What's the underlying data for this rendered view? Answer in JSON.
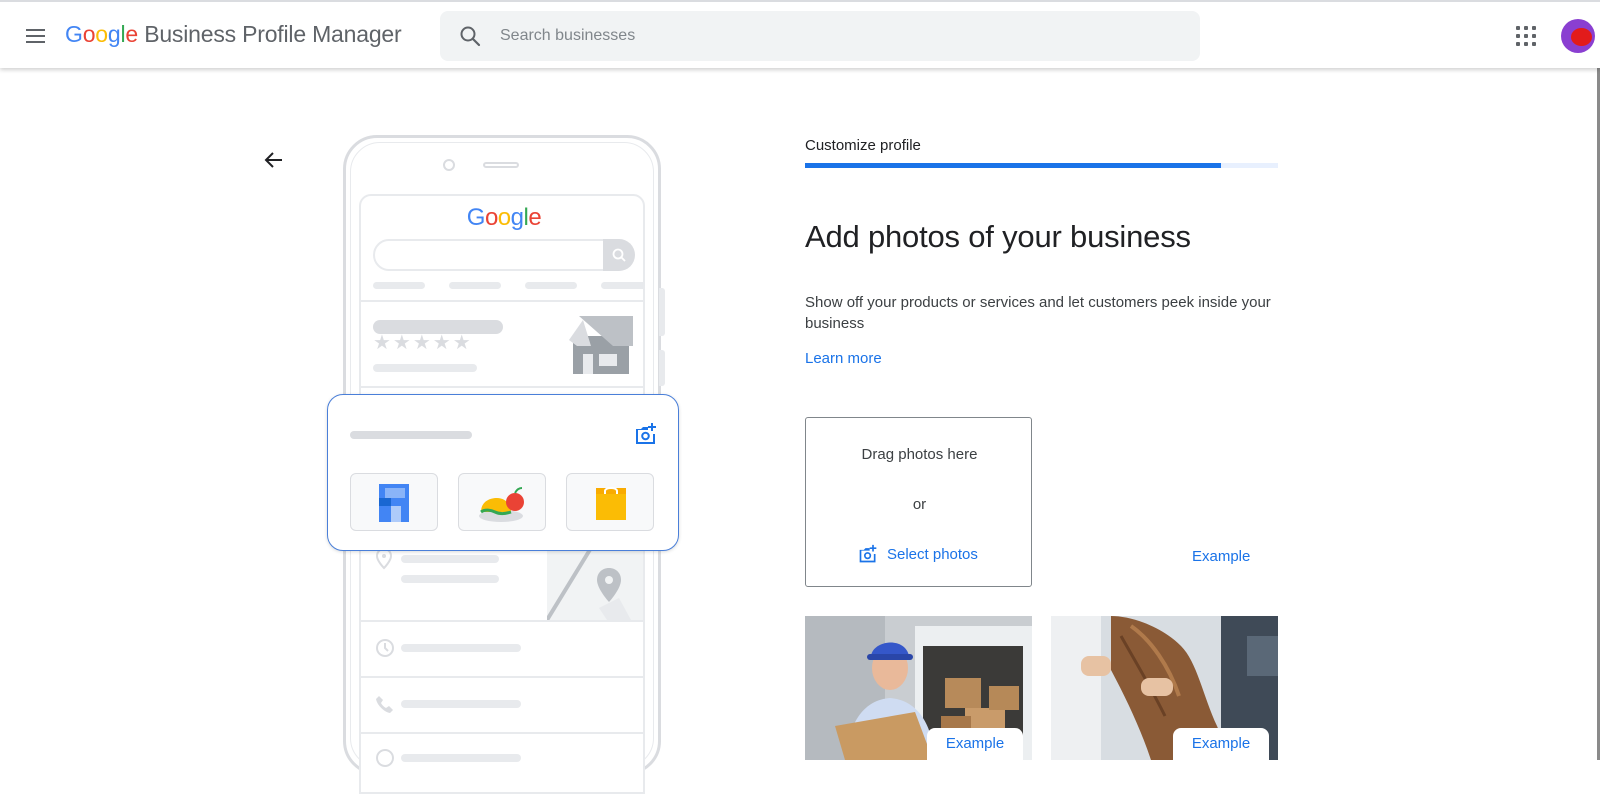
{
  "header": {
    "brand_google": [
      "G",
      "o",
      "o",
      "g",
      "l",
      "e"
    ],
    "brand_rest": "Business Profile Manager",
    "search_placeholder": "Search businesses",
    "menu_icon": "hamburger-menu-icon",
    "apps_icon": "apps-grid-icon"
  },
  "illustration": {
    "mini_logo": [
      "G",
      "o",
      "o",
      "g",
      "l",
      "e"
    ]
  },
  "main": {
    "step_label": "Customize profile",
    "progress_percent": 88,
    "title": "Add photos of your business",
    "description": "Show off your products or services and let customers peek inside your business",
    "learn_more": "Learn more",
    "dropzone": {
      "drag_text": "Drag photos here",
      "or_text": "or",
      "select_label": "Select photos"
    },
    "example_labels": [
      "Example",
      "Example",
      "Example"
    ]
  },
  "colors": {
    "accent": "#1a73e8",
    "google_blue": "#4285f4",
    "google_red": "#ea4335",
    "google_yellow": "#fbbc05",
    "google_green": "#34a853"
  }
}
